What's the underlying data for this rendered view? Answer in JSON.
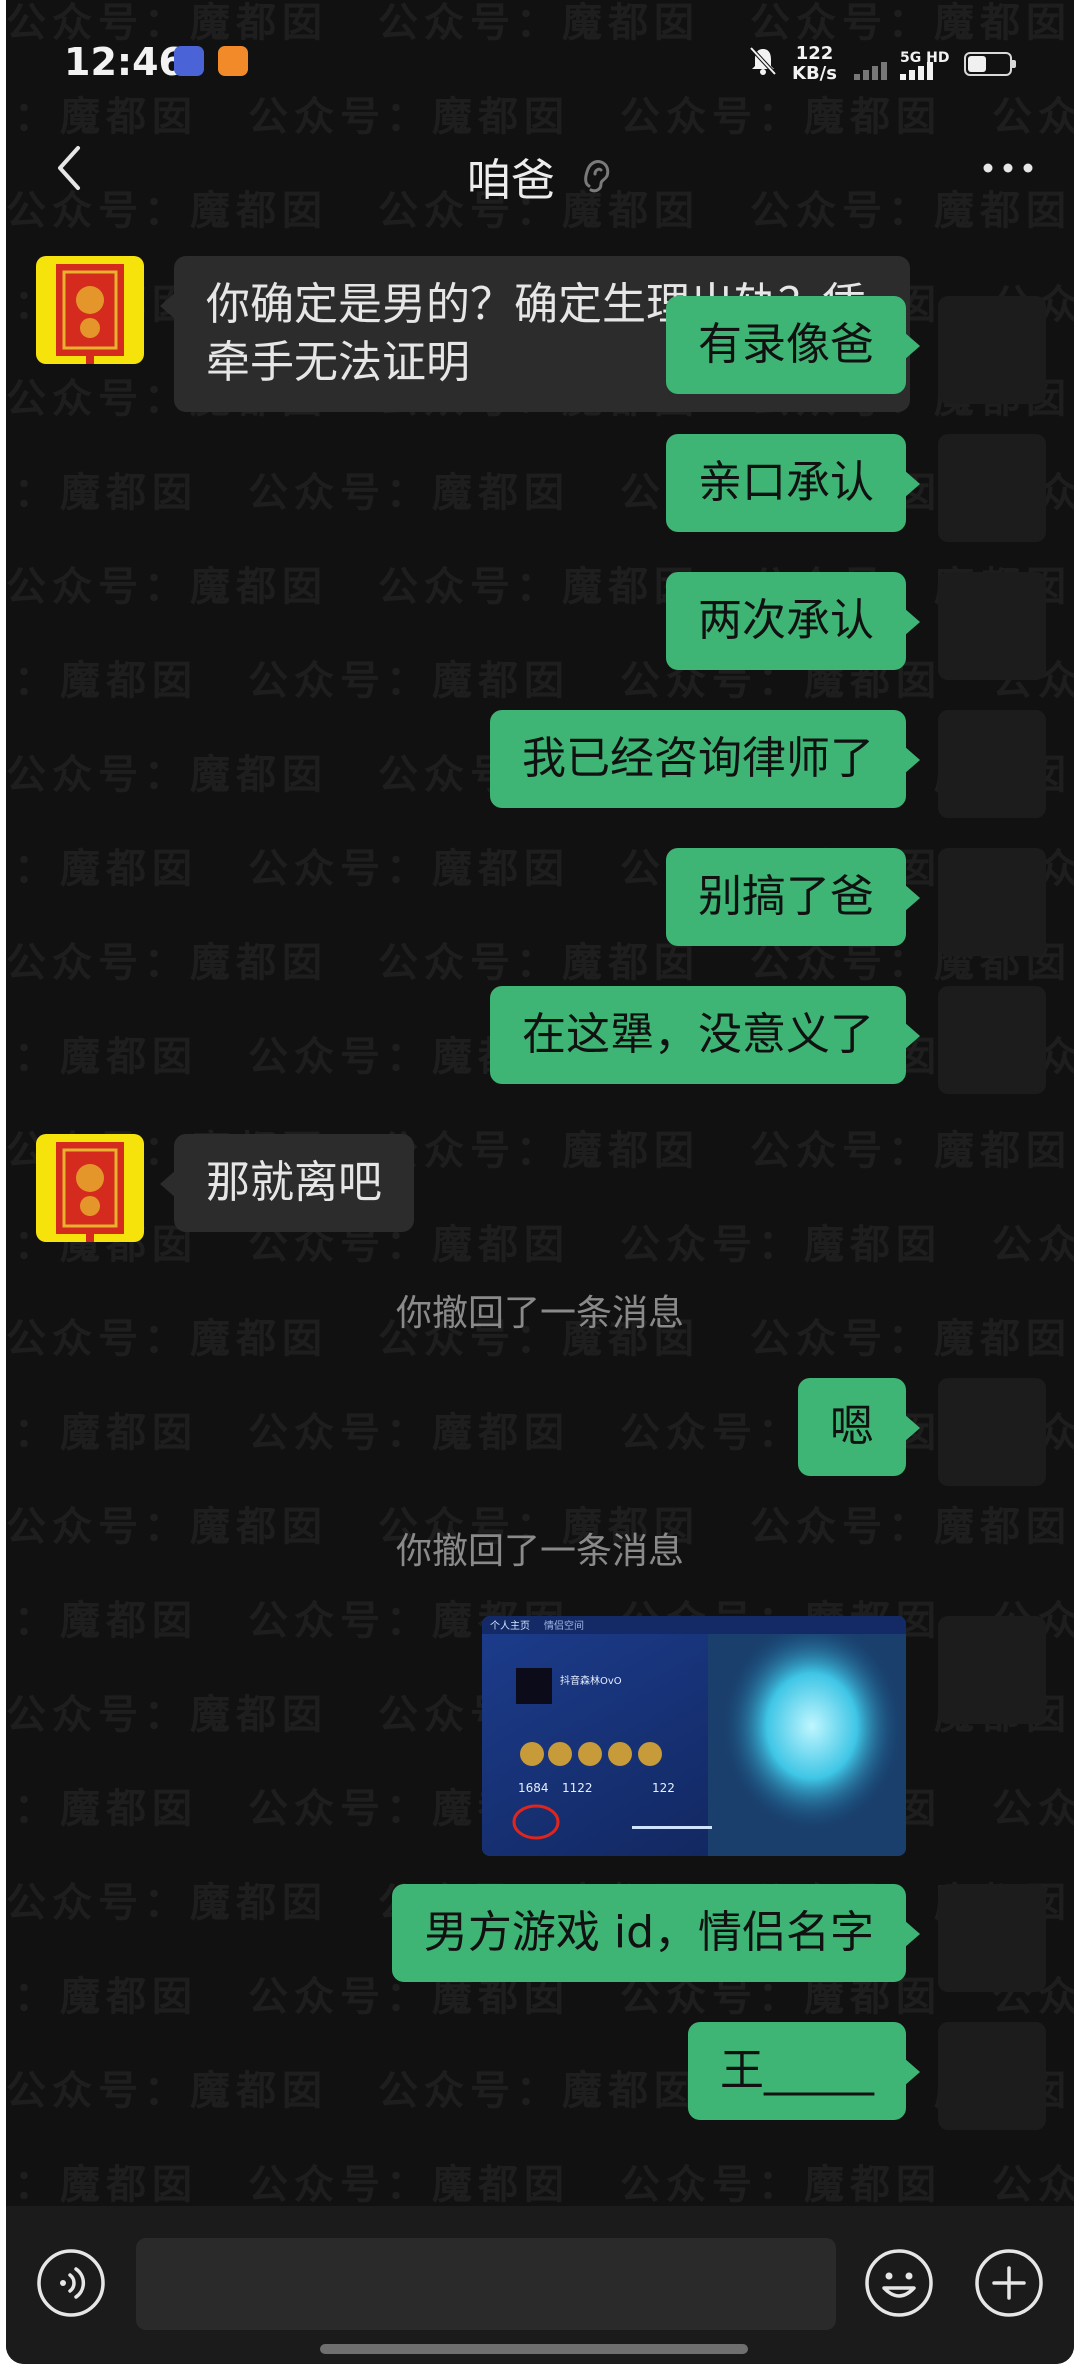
{
  "status_bar": {
    "time": "12:46",
    "speed_value": "122",
    "speed_unit": "KB/s",
    "network": "5G HD"
  },
  "header": {
    "title": "咱爸"
  },
  "watermark": "公众号：魔都囡",
  "messages": [
    {
      "side": "left",
      "text": "你确定是男的？确定生理出轨？凭牵手无法证明"
    },
    {
      "side": "right",
      "text": "有录像爸"
    },
    {
      "side": "right",
      "text": "亲口承认"
    },
    {
      "side": "right",
      "text": "两次承认"
    },
    {
      "side": "right",
      "text": "我已经咨询律师了"
    },
    {
      "side": "right",
      "text": "别搞了爸"
    },
    {
      "side": "right",
      "text": "在这犟，没意义了"
    },
    {
      "side": "left",
      "text": "那就离吧"
    },
    {
      "side": "system",
      "text": "你撤回了一条消息"
    },
    {
      "side": "right",
      "text": "嗯"
    },
    {
      "side": "system",
      "text": "你撤回了一条消息"
    },
    {
      "side": "right",
      "type": "image",
      "text": "个人主页"
    },
    {
      "side": "right",
      "text": "男方游戏 id，情侣名字"
    },
    {
      "side": "right",
      "text": "王_____"
    }
  ],
  "screenshot_labels": {
    "tab1": "个人主页",
    "tab2": "情侣空间",
    "username": "抖音森林OvO",
    "stat1": "1684",
    "stat2": "1122",
    "stat3": "122"
  },
  "colors": {
    "background": "#111111",
    "my_bubble": "#3eb575",
    "their_bubble": "#2c2c2c",
    "dad_avatar": "#f7e30c"
  },
  "icons": {
    "back": "chevron-left-icon",
    "earpiece": "ear-icon",
    "more": "more-dots-icon",
    "voice": "voice-icon",
    "emoji": "emoji-icon",
    "plus": "plus-icon"
  }
}
